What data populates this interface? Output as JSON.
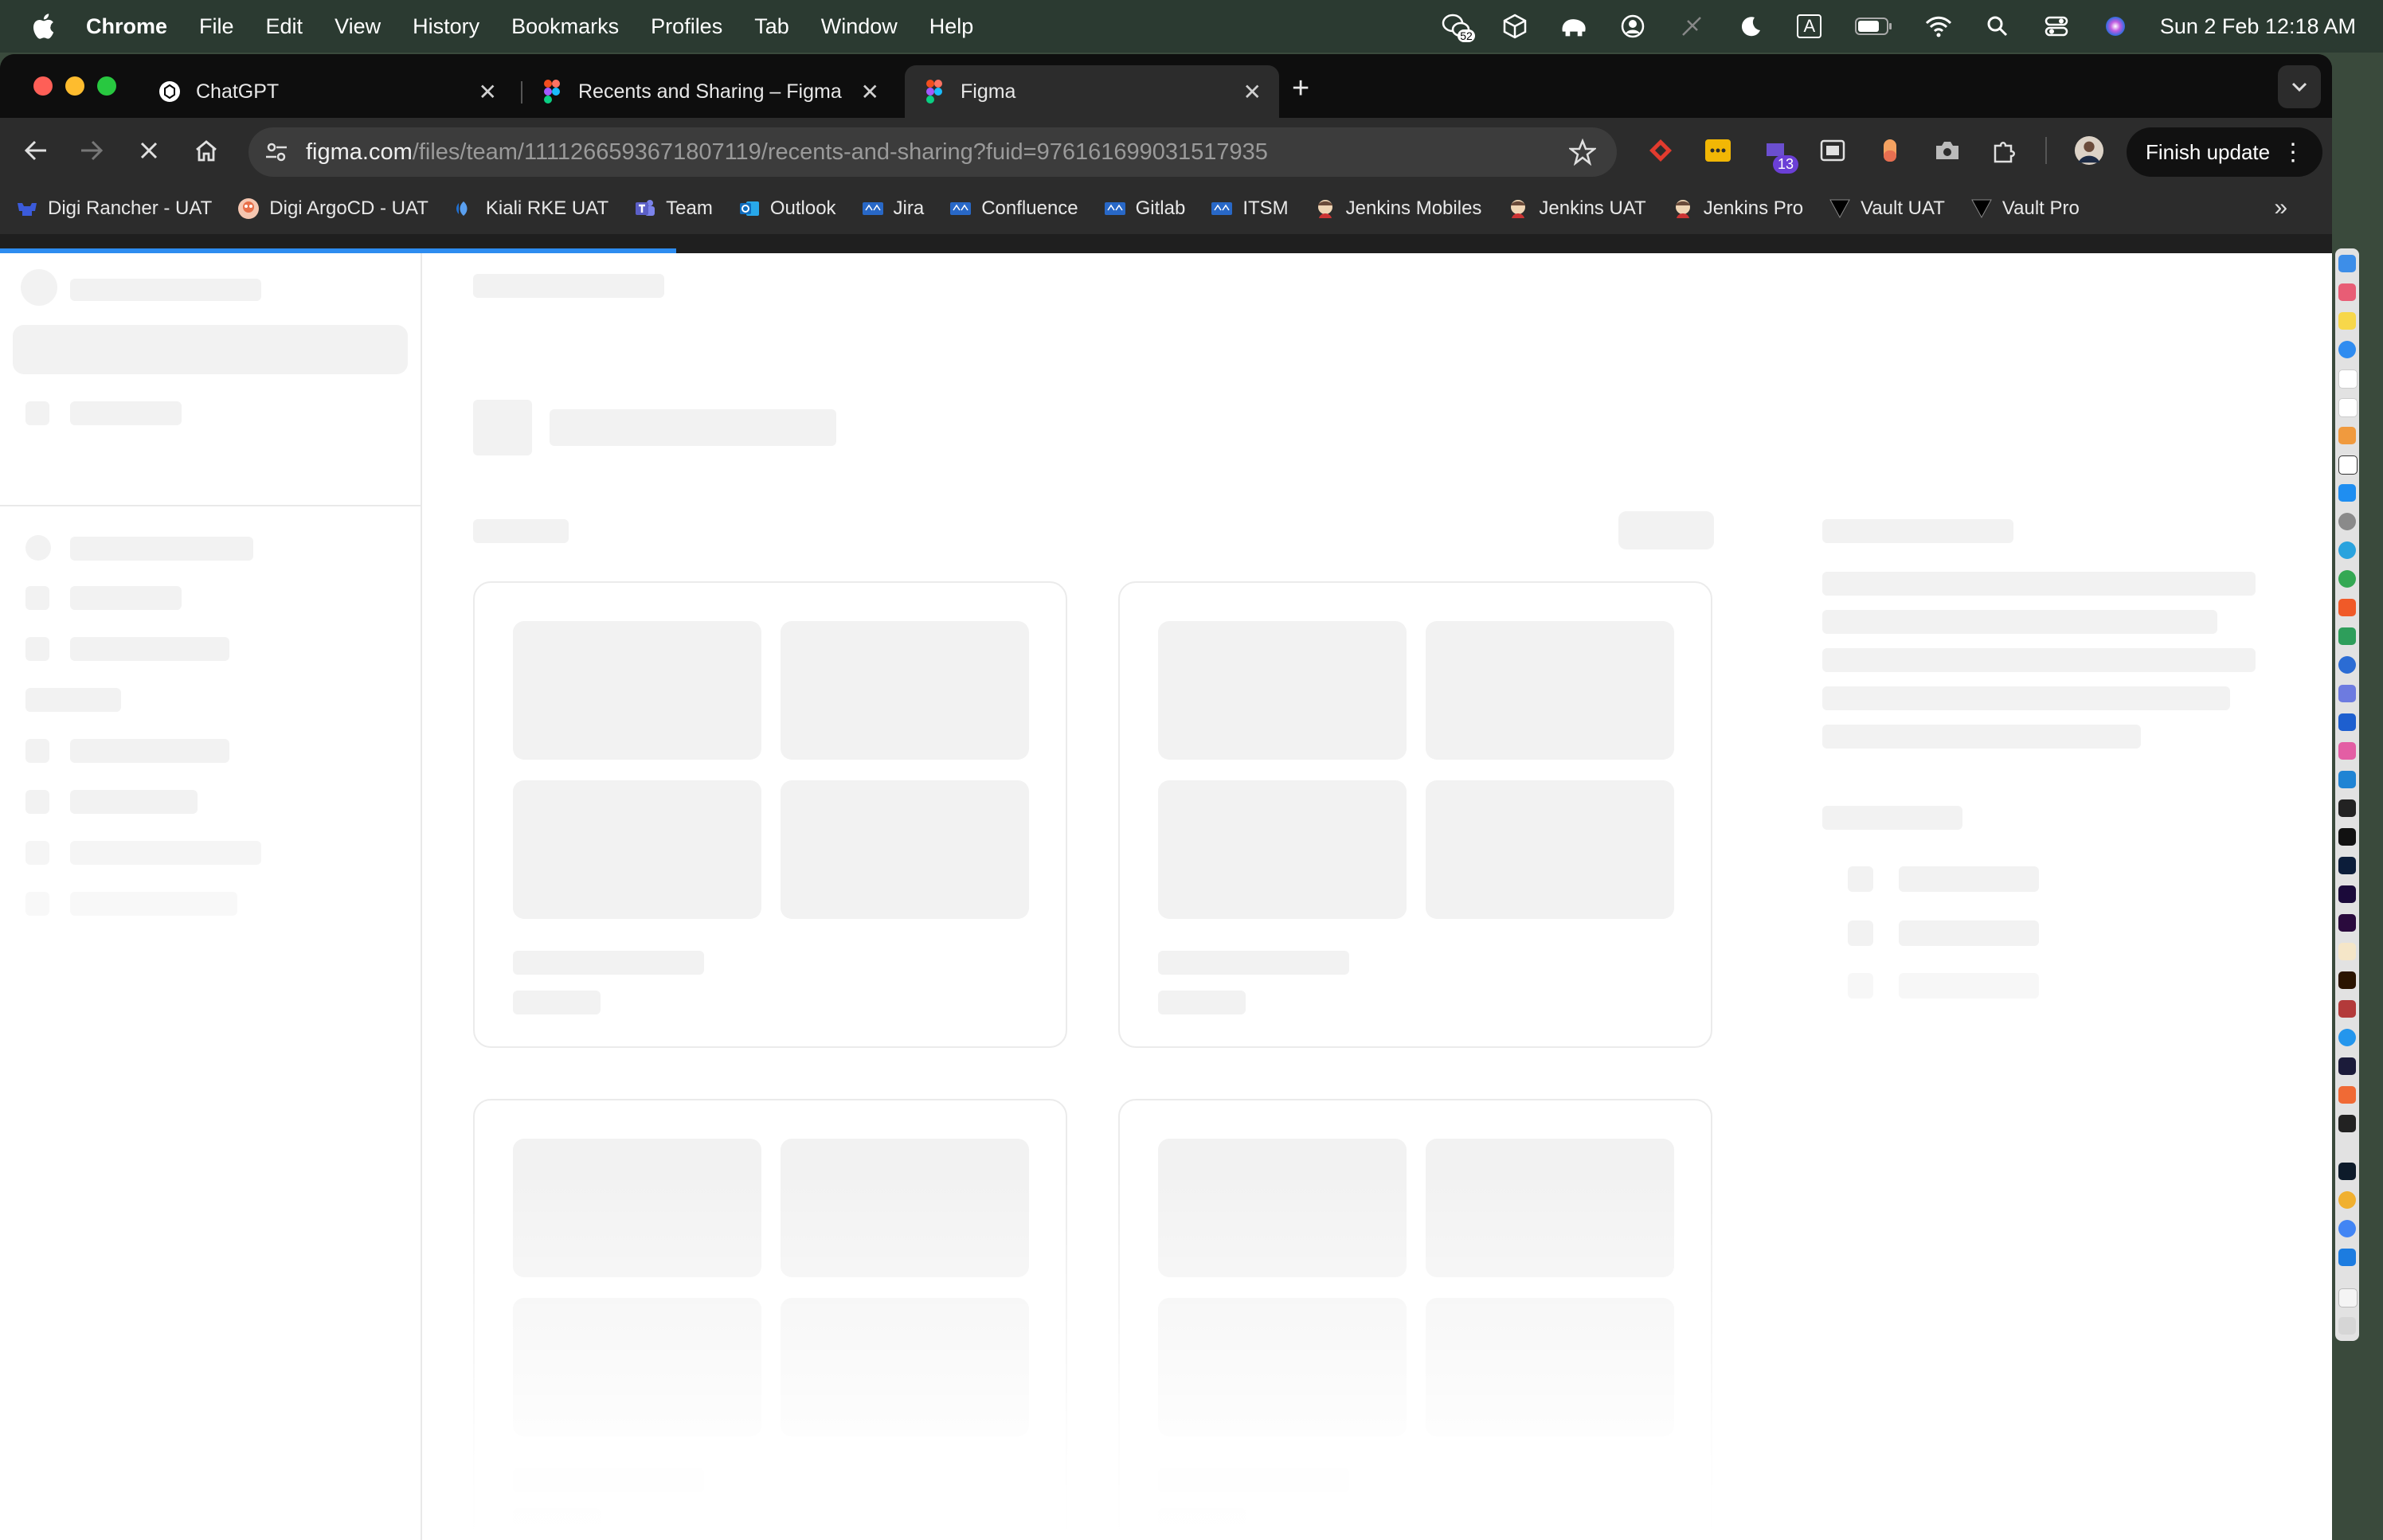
{
  "menubar": {
    "app_name": "Chrome",
    "menus": [
      "File",
      "Edit",
      "View",
      "History",
      "Bookmarks",
      "Profiles",
      "Tab",
      "Window",
      "Help"
    ],
    "notification_count": "52",
    "input_source": "A",
    "clock": "Sun 2 Feb  12:18 AM"
  },
  "tabs": [
    {
      "title": "ChatGPT",
      "favicon": "chatgpt-icon"
    },
    {
      "title": "Recents and Sharing – Figma",
      "favicon": "figma-icon"
    },
    {
      "title": "Figma",
      "favicon": "figma-icon"
    }
  ],
  "toolbar": {
    "url_host": "figma.com",
    "url_path": "/files/team/1111266593671807119/recents-and-sharing?fuid=976161699031517935",
    "extension_badge": "13",
    "finish_update_label": "Finish update"
  },
  "bookmarks": [
    {
      "label": "Digi Rancher - UAT",
      "icon": "rancher-icon",
      "color": "#3b5bdb"
    },
    {
      "label": "Digi ArgoCD - UAT",
      "icon": "argocd-icon",
      "color": "#e8704a"
    },
    {
      "label": "Kiali RKE UAT",
      "icon": "kiali-icon",
      "color": "#1f6fd1"
    },
    {
      "label": "Team",
      "icon": "teams-icon",
      "color": "#5b5fc7"
    },
    {
      "label": "Outlook",
      "icon": "outlook-icon",
      "color": "#0f6cbd"
    },
    {
      "label": "Jira",
      "icon": "atlassian-icon",
      "color": "#2868c7"
    },
    {
      "label": "Confluence",
      "icon": "atlassian-icon",
      "color": "#2868c7"
    },
    {
      "label": "Gitlab",
      "icon": "atlassian-icon",
      "color": "#2868c7"
    },
    {
      "label": "ITSM",
      "icon": "atlassian-icon",
      "color": "#2868c7"
    },
    {
      "label": "Jenkins Mobiles",
      "icon": "jenkins-icon",
      "color": "#d9b38c"
    },
    {
      "label": "Jenkins UAT",
      "icon": "jenkins-icon",
      "color": "#d9b38c"
    },
    {
      "label": "Jenkins Pro",
      "icon": "jenkins-icon",
      "color": "#d9b38c"
    },
    {
      "label": "Vault UAT",
      "icon": "vault-icon",
      "color": "#000000"
    },
    {
      "label": "Vault Pro",
      "icon": "vault-icon",
      "color": "#000000"
    }
  ],
  "page": {
    "state": "loading",
    "loading_progress": 0.29
  }
}
